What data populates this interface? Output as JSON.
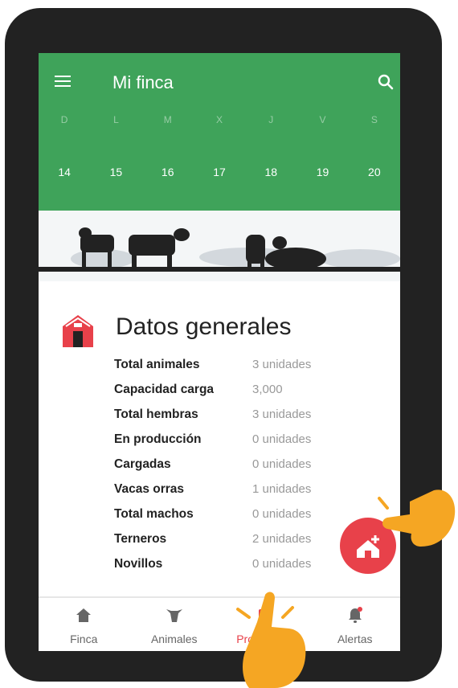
{
  "header": {
    "title": "Mi finca",
    "menu_icon": "hamburger-menu-icon",
    "search_icon": "search-icon"
  },
  "calendar": {
    "days": [
      "D",
      "L",
      "M",
      "X",
      "J",
      "V",
      "S"
    ],
    "dates": [
      "14",
      "15",
      "16",
      "17",
      "18",
      "19",
      "20"
    ]
  },
  "general_data": {
    "title": "Datos generales",
    "icon": "barn-icon",
    "rows": [
      {
        "label": "Total animales",
        "value": "3 unidades"
      },
      {
        "label": "Capacidad carga",
        "value": "3,000"
      },
      {
        "label": "Total hembras",
        "value": "3 unidades"
      },
      {
        "label": "En producción",
        "value": "0 unidades"
      },
      {
        "label": "Cargadas",
        "value": "0 unidades"
      },
      {
        "label": "Vacas orras",
        "value": "1 unidades"
      },
      {
        "label": "Total machos",
        "value": "0 unidades"
      },
      {
        "label": "Terneros",
        "value": "2 unidades"
      },
      {
        "label": "Novillos",
        "value": "0 unidades"
      }
    ]
  },
  "fab": {
    "icon": "add-barn-icon",
    "color": "#e8414a"
  },
  "bottom_nav": {
    "items": [
      {
        "label": "Finca",
        "icon": "home-icon"
      },
      {
        "label": "Animales",
        "icon": "cow-icon"
      },
      {
        "label": "Producción",
        "icon": "production-icon",
        "active": true
      },
      {
        "label": "Alertas",
        "icon": "bell-icon"
      }
    ]
  },
  "colors": {
    "primary_green": "#3fa35a",
    "accent_red": "#e8414a",
    "hand_orange": "#f5a623",
    "frame": "#222222"
  }
}
